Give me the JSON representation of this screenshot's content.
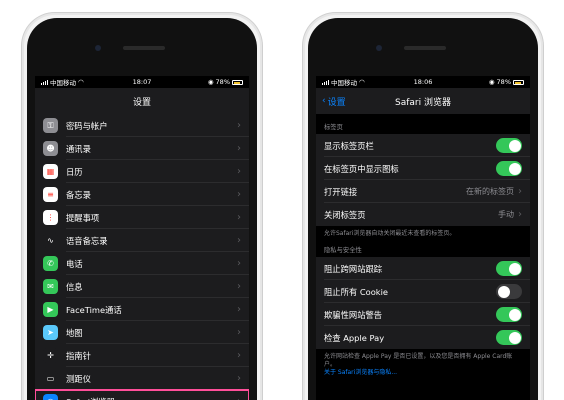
{
  "left": {
    "status": {
      "carrier": "中国移动",
      "time": "18:07",
      "battery": "78%"
    },
    "title": "设置",
    "items": [
      {
        "label": "密码与帐户",
        "icon": "key-icon",
        "color": "#8e8e93",
        "glyph": "⚿"
      },
      {
        "label": "通讯录",
        "icon": "contacts-icon",
        "color": "#8e8e93",
        "glyph": "☻"
      },
      {
        "label": "日历",
        "icon": "calendar-icon",
        "color": "#ffffff",
        "glyph": "▦"
      },
      {
        "label": "备忘录",
        "icon": "notes-icon",
        "color": "#ffffff",
        "glyph": "≡"
      },
      {
        "label": "提醒事项",
        "icon": "reminders-icon",
        "color": "#ffffff",
        "glyph": "⋮"
      },
      {
        "label": "语音备忘录",
        "icon": "voice-memo-icon",
        "color": "#1c1c1e",
        "glyph": "∿"
      },
      {
        "label": "电话",
        "icon": "phone-icon",
        "color": "#34c759",
        "glyph": "✆"
      },
      {
        "label": "信息",
        "icon": "messages-icon",
        "color": "#34c759",
        "glyph": "✉"
      },
      {
        "label": "FaceTime通话",
        "icon": "facetime-icon",
        "color": "#34c759",
        "glyph": "▶"
      },
      {
        "label": "地图",
        "icon": "maps-icon",
        "color": "#5ac8fa",
        "glyph": "➤"
      },
      {
        "label": "指南针",
        "icon": "compass-icon",
        "color": "#1c1c1e",
        "glyph": "✛"
      },
      {
        "label": "测距仪",
        "icon": "measure-icon",
        "color": "#1c1c1e",
        "glyph": "▭"
      },
      {
        "label": "Safari浏览器",
        "icon": "safari-icon",
        "color": "#0a84ff",
        "glyph": "◎"
      }
    ]
  },
  "right": {
    "status": {
      "carrier": "中国移动",
      "time": "18:06",
      "battery": "78%"
    },
    "back_label": "设置",
    "title": "Safari 浏览器",
    "tabs_section": {
      "header": "标签页",
      "rows": [
        {
          "label": "显示标签页栏",
          "toggle": "on"
        },
        {
          "label": "在标签页中显示图标",
          "toggle": "on"
        },
        {
          "label": "打开链接",
          "value": "在新的标签页"
        },
        {
          "label": "关闭标签页",
          "value": "手动"
        }
      ],
      "footnote": "允许Safari浏览器自动关闭最近未查看的标签页。"
    },
    "privacy_section": {
      "header": "隐私与安全性",
      "rows": [
        {
          "label": "阻止跨网站跟踪",
          "toggle": "on"
        },
        {
          "label": "阻止所有 Cookie",
          "toggle": "off"
        },
        {
          "label": "欺骗性网站警告",
          "toggle": "on"
        },
        {
          "label": "检查 Apple Pay",
          "toggle": "on"
        }
      ],
      "footnote": "允许网站检查 Apple Pay 是否已设置，以及您是否拥有 Apple Card账户。",
      "footnote_link": "关于 Safari浏览器与隐私..."
    }
  },
  "colors": {
    "toggle_on": "#34c759",
    "link": "#0a84ff",
    "highlight": "#ff4f9a"
  }
}
